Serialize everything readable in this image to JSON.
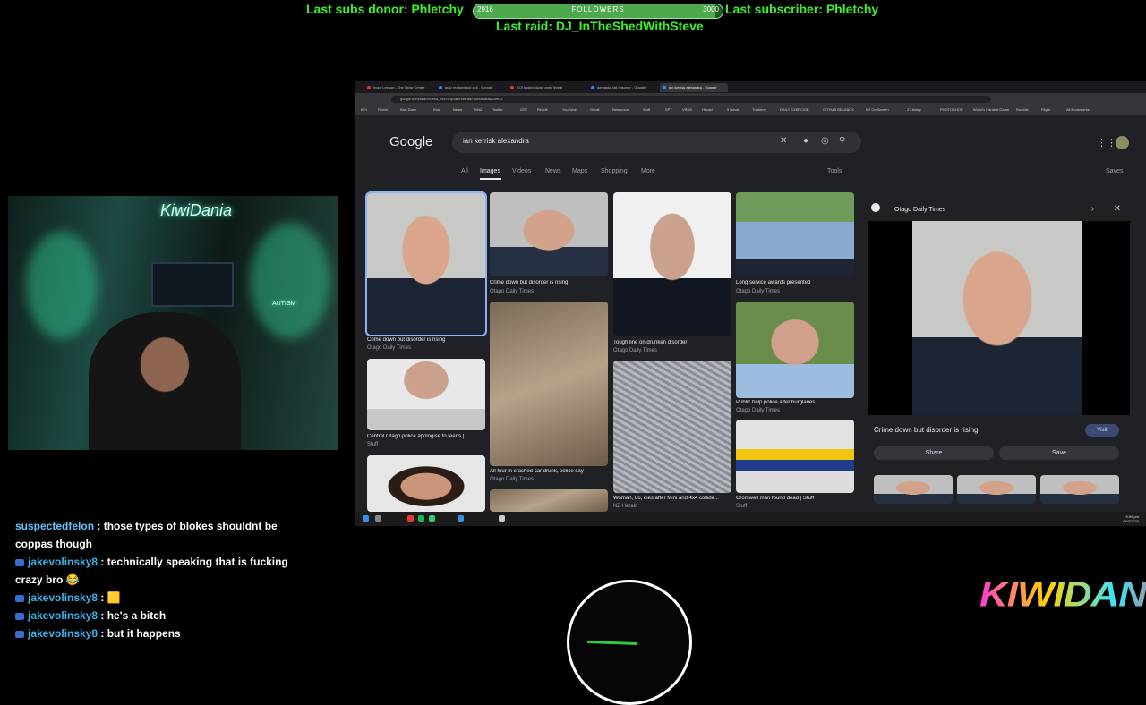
{
  "overlay": {
    "last_subs_donor": "Last subs donor: Phletchy",
    "last_subscriber": "Last subscriber: Phletchy",
    "last_raid": "Last raid: DJ_InTheShedWithSteve",
    "followers": {
      "label": "FOLLOWERS",
      "current": "2916",
      "goal": "3000",
      "progress": 0.972
    }
  },
  "browser": {
    "tabs": [
      {
        "label": "Ingor Leeson - The Grow Centre"
      },
      {
        "label": "auto realized pal cell - Google"
      },
      {
        "label": "KOI locked down amid threat"
      },
      {
        "label": "damaska jail prisoner - Google"
      },
      {
        "label": "ian kerrisk alexandra - Google"
      }
    ],
    "url": "google.com/search?sca_esv=&q=ian+kerrisk+alexandra&udm=2",
    "bookmarks": [
      "KOI",
      "Remix",
      "Kick Dash",
      "Kick",
      "News",
      "TVNZ",
      "Twitter",
      "OST",
      "Reddit",
      "YouTube",
      "Gmail",
      "Newsroom",
      "Stuff",
      "SPT",
      "VRDE",
      "Herald",
      "5 News",
      "Trademe",
      "DAILY EXERCISE",
      "GITHUB BELABOX",
      "NZ On Screen",
      "Z Library",
      "PHOTOSHOP",
      "World's Hardest Game",
      "Rumble",
      "Flight",
      "All Bookmarks"
    ]
  },
  "google": {
    "logo": "Google",
    "query": "ian kerrisk alexandra",
    "tabs": [
      "All",
      "Images",
      "Videos",
      "News",
      "Maps",
      "Shopping",
      "More"
    ],
    "active_tab": "Images",
    "tools": "Tools",
    "saves": "Saves",
    "results": [
      {
        "caption": "Crime down but disorder is rising",
        "source": "Otago Daily Times"
      },
      {
        "caption": "Crime down but disorder is rising",
        "source": "Otago Daily Times"
      },
      {
        "caption": "Tough line on drunken disorder",
        "source": "Otago Daily Times"
      },
      {
        "caption": "Long service awards presented",
        "source": "Otago Daily Times"
      },
      {
        "caption": "All four in crashed car drunk, police say",
        "source": "Otago Daily Times"
      },
      {
        "caption": "Public help police after burglaries",
        "source": "Otago Daily Times"
      },
      {
        "caption": "Central Otago police apologise to teens |...",
        "source": "Stuff"
      },
      {
        "caption": "Woman, 86, dies after Mini and 4x4 collide...",
        "source": "NZ Herald"
      },
      {
        "caption": "Cromwell man found dead | Stuff",
        "source": "Stuff"
      }
    ],
    "side_panel": {
      "source": "Otago Daily Times",
      "title": "Crime down but disorder is rising",
      "visit": "Visit",
      "share": "Share",
      "save": "Save"
    }
  },
  "taskbar": {
    "time": "5:59 pm",
    "date": "6/03/2026",
    "weather": "8°C Partly sunny",
    "lang": "ENG"
  },
  "webcam": {
    "neon_sign": "KiwiDania",
    "sign": "AUTISM"
  },
  "chat": [
    {
      "user": "suspectedfelon",
      "text": " : those types of blokes shouldnt be coppas though",
      "badge": false
    },
    {
      "user": "jakevolinsky8",
      "text": " : technically speaking that is fucking crazy bro 😂",
      "badge": true
    },
    {
      "user": "jakevolinsky8",
      "text": " : 🟨",
      "badge": true
    },
    {
      "user": "jakevolinsky8",
      "text": " : he's a bitch",
      "badge": true
    },
    {
      "user": "jakevolinsky8",
      "text": " : but it happens",
      "badge": true
    }
  ],
  "brand_logo": "KIWIDANIA"
}
